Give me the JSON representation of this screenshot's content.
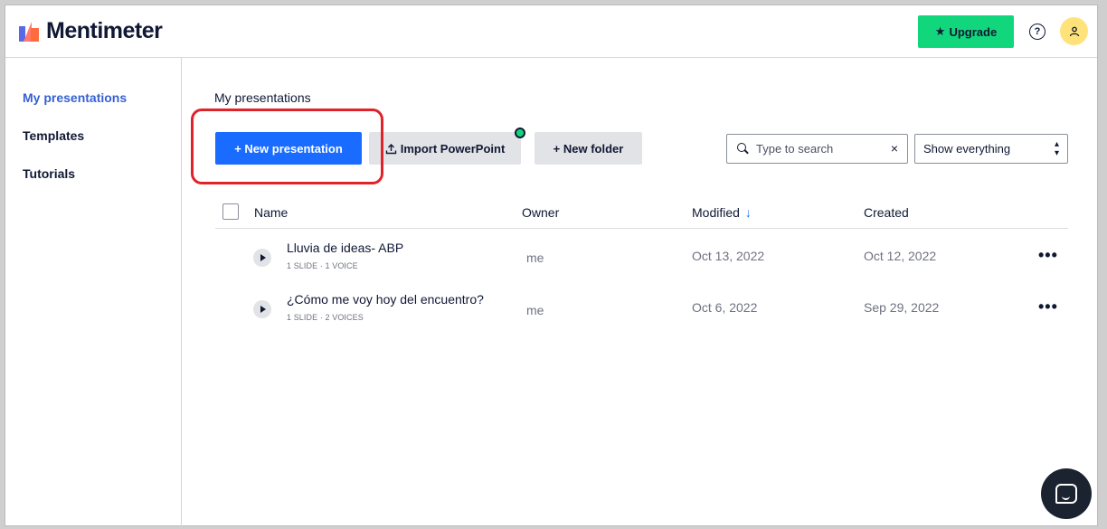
{
  "brand": {
    "name": "Mentimeter"
  },
  "header": {
    "upgrade_label": "Upgrade",
    "help_symbol": "?",
    "icons": {
      "upgrade": "star-icon",
      "help": "question-circle-icon",
      "avatar": "user-icon"
    }
  },
  "sidebar": {
    "items": [
      {
        "label": "My presentations",
        "active": true
      },
      {
        "label": "Templates",
        "active": false
      },
      {
        "label": "Tutorials",
        "active": false
      }
    ]
  },
  "main": {
    "title": "My presentations",
    "new_presentation_label": "+ New presentation",
    "import_label": "Import PowerPoint",
    "new_folder_label": "+ New folder",
    "search": {
      "placeholder": "Type to search",
      "value": "",
      "clear_symbol": "×"
    },
    "filter": {
      "selected": "Show everything"
    }
  },
  "table": {
    "columns": {
      "name": "Name",
      "owner": "Owner",
      "modified": "Modified",
      "created": "Created"
    },
    "sort_indicator": "↓",
    "rows": [
      {
        "name": "Lluvia de ideas- ABP",
        "meta": "1 SLIDE · 1 VOICE",
        "owner": "me",
        "modified": "Oct 13, 2022",
        "created": "Oct 12, 2022"
      },
      {
        "name": "¿Cómo me voy hoy del encuentro?",
        "meta": "1 SLIDE · 2 VOICES",
        "owner": "me",
        "modified": "Oct 6, 2022",
        "created": "Sep 29, 2022"
      }
    ],
    "more_symbol": "•••"
  },
  "colors": {
    "primary": "#196cff",
    "upgrade": "#12d67c",
    "active_nav": "#3661d4",
    "highlight": "#e0232b",
    "avatar": "#ffe37a"
  }
}
